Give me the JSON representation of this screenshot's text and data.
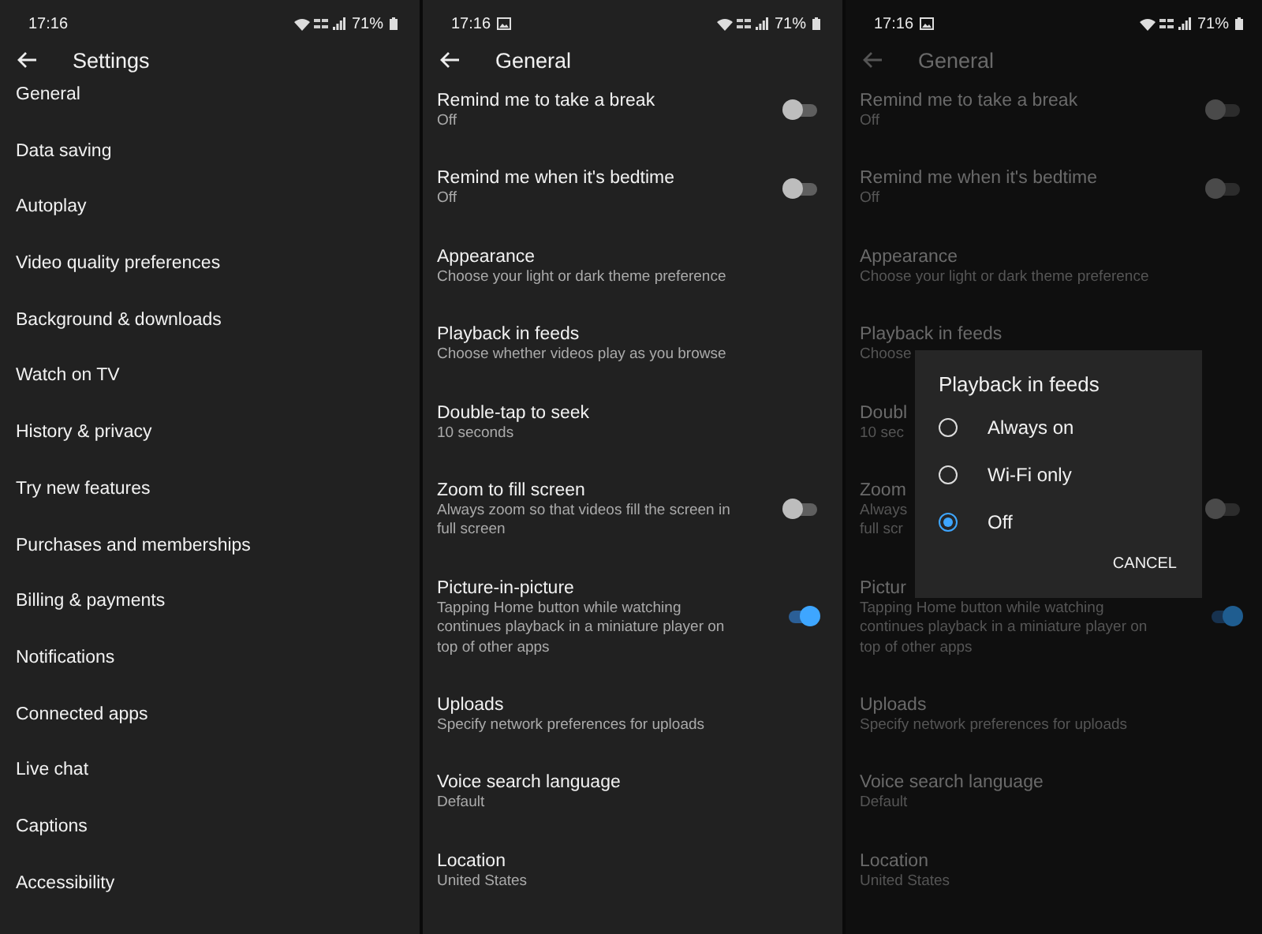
{
  "settings_screen": {
    "status_bar": {
      "time": "17:16",
      "battery": "71%"
    },
    "title": "Settings",
    "items": [
      "General",
      "Data saving",
      "Autoplay",
      "Video quality preferences",
      "Background & downloads",
      "Watch on TV",
      "History & privacy",
      "Try new features",
      "Purchases and memberships",
      "Billing & payments",
      "Notifications",
      "Connected apps",
      "Live chat",
      "Captions",
      "Accessibility"
    ]
  },
  "general_screen": {
    "status_bar": {
      "time": "17:16",
      "battery": "71%",
      "gallery_notification": true
    },
    "title": "General",
    "items": [
      {
        "title": "Remind me to take a break",
        "subtitle": "Off",
        "kind": "toggle",
        "on": false
      },
      {
        "title": "Remind me when it's bedtime",
        "subtitle": "Off",
        "kind": "toggle",
        "on": false
      },
      {
        "title": "Appearance",
        "subtitle": "Choose your light or dark theme preference",
        "kind": "plain"
      },
      {
        "title": "Playback in feeds",
        "subtitle": "Choose whether videos play as you browse",
        "kind": "plain"
      },
      {
        "title": "Double-tap to seek",
        "subtitle": "10 seconds",
        "kind": "plain"
      },
      {
        "title": "Zoom to fill screen",
        "subtitle": "Always zoom so that videos fill the screen in full screen",
        "kind": "toggle",
        "on": false
      },
      {
        "title": "Picture-in-picture",
        "subtitle": "Tapping Home button while watching continues playback in a miniature player on top of other apps",
        "kind": "toggle",
        "on": true
      },
      {
        "title": "Uploads",
        "subtitle": "Specify network preferences for uploads",
        "kind": "plain"
      },
      {
        "title": "Voice search language",
        "subtitle": "Default",
        "kind": "plain"
      },
      {
        "title": "Location",
        "subtitle": "United States",
        "kind": "plain"
      }
    ]
  },
  "dialog_screen": {
    "status_bar": {
      "time": "17:16",
      "battery": "71%",
      "gallery_notification": true
    },
    "title": "General",
    "items": [
      {
        "title": "Remind me to take a break",
        "subtitle": "Off",
        "kind": "toggle",
        "on": false
      },
      {
        "title": "Remind me when it's bedtime",
        "subtitle": "Off",
        "kind": "toggle",
        "on": false
      },
      {
        "title": "Appearance",
        "subtitle": "Choose your light or dark theme preference",
        "kind": "plain"
      },
      {
        "title": "Playback in feeds",
        "subtitle": "Choose",
        "kind": "plain"
      },
      {
        "title": "Doubl",
        "subtitle": "10 sec",
        "kind": "plain"
      },
      {
        "title": "Zoom",
        "subtitle": "Always\nfull scr",
        "kind": "toggle",
        "on": false
      },
      {
        "title": "Pictur",
        "subtitle": "Tapping Home button while watching continues playback in a miniature player on top of other apps",
        "kind": "toggle",
        "on": true
      },
      {
        "title": "Uploads",
        "subtitle": "Specify network preferences for uploads",
        "kind": "plain"
      },
      {
        "title": "Voice search language",
        "subtitle": "Default",
        "kind": "plain"
      },
      {
        "title": "Location",
        "subtitle": "United States",
        "kind": "plain"
      }
    ],
    "dialog": {
      "title": "Playback in feeds",
      "options": [
        {
          "label": "Always on",
          "selected": false
        },
        {
          "label": "Wi-Fi only",
          "selected": false
        },
        {
          "label": "Off",
          "selected": true
        }
      ],
      "button": "CANCEL"
    }
  }
}
